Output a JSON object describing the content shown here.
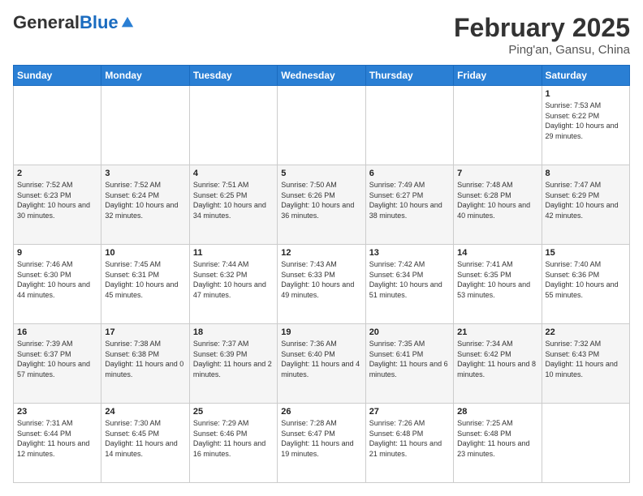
{
  "logo": {
    "general": "General",
    "blue": "Blue"
  },
  "header": {
    "month_year": "February 2025",
    "location": "Ping'an, Gansu, China"
  },
  "weekdays": [
    "Sunday",
    "Monday",
    "Tuesday",
    "Wednesday",
    "Thursday",
    "Friday",
    "Saturday"
  ],
  "weeks": [
    [
      {
        "day": "",
        "info": ""
      },
      {
        "day": "",
        "info": ""
      },
      {
        "day": "",
        "info": ""
      },
      {
        "day": "",
        "info": ""
      },
      {
        "day": "",
        "info": ""
      },
      {
        "day": "",
        "info": ""
      },
      {
        "day": "1",
        "info": "Sunrise: 7:53 AM\nSunset: 6:22 PM\nDaylight: 10 hours and 29 minutes."
      }
    ],
    [
      {
        "day": "2",
        "info": "Sunrise: 7:52 AM\nSunset: 6:23 PM\nDaylight: 10 hours and 30 minutes."
      },
      {
        "day": "3",
        "info": "Sunrise: 7:52 AM\nSunset: 6:24 PM\nDaylight: 10 hours and 32 minutes."
      },
      {
        "day": "4",
        "info": "Sunrise: 7:51 AM\nSunset: 6:25 PM\nDaylight: 10 hours and 34 minutes."
      },
      {
        "day": "5",
        "info": "Sunrise: 7:50 AM\nSunset: 6:26 PM\nDaylight: 10 hours and 36 minutes."
      },
      {
        "day": "6",
        "info": "Sunrise: 7:49 AM\nSunset: 6:27 PM\nDaylight: 10 hours and 38 minutes."
      },
      {
        "day": "7",
        "info": "Sunrise: 7:48 AM\nSunset: 6:28 PM\nDaylight: 10 hours and 40 minutes."
      },
      {
        "day": "8",
        "info": "Sunrise: 7:47 AM\nSunset: 6:29 PM\nDaylight: 10 hours and 42 minutes."
      }
    ],
    [
      {
        "day": "9",
        "info": "Sunrise: 7:46 AM\nSunset: 6:30 PM\nDaylight: 10 hours and 44 minutes."
      },
      {
        "day": "10",
        "info": "Sunrise: 7:45 AM\nSunset: 6:31 PM\nDaylight: 10 hours and 45 minutes."
      },
      {
        "day": "11",
        "info": "Sunrise: 7:44 AM\nSunset: 6:32 PM\nDaylight: 10 hours and 47 minutes."
      },
      {
        "day": "12",
        "info": "Sunrise: 7:43 AM\nSunset: 6:33 PM\nDaylight: 10 hours and 49 minutes."
      },
      {
        "day": "13",
        "info": "Sunrise: 7:42 AM\nSunset: 6:34 PM\nDaylight: 10 hours and 51 minutes."
      },
      {
        "day": "14",
        "info": "Sunrise: 7:41 AM\nSunset: 6:35 PM\nDaylight: 10 hours and 53 minutes."
      },
      {
        "day": "15",
        "info": "Sunrise: 7:40 AM\nSunset: 6:36 PM\nDaylight: 10 hours and 55 minutes."
      }
    ],
    [
      {
        "day": "16",
        "info": "Sunrise: 7:39 AM\nSunset: 6:37 PM\nDaylight: 10 hours and 57 minutes."
      },
      {
        "day": "17",
        "info": "Sunrise: 7:38 AM\nSunset: 6:38 PM\nDaylight: 11 hours and 0 minutes."
      },
      {
        "day": "18",
        "info": "Sunrise: 7:37 AM\nSunset: 6:39 PM\nDaylight: 11 hours and 2 minutes."
      },
      {
        "day": "19",
        "info": "Sunrise: 7:36 AM\nSunset: 6:40 PM\nDaylight: 11 hours and 4 minutes."
      },
      {
        "day": "20",
        "info": "Sunrise: 7:35 AM\nSunset: 6:41 PM\nDaylight: 11 hours and 6 minutes."
      },
      {
        "day": "21",
        "info": "Sunrise: 7:34 AM\nSunset: 6:42 PM\nDaylight: 11 hours and 8 minutes."
      },
      {
        "day": "22",
        "info": "Sunrise: 7:32 AM\nSunset: 6:43 PM\nDaylight: 11 hours and 10 minutes."
      }
    ],
    [
      {
        "day": "23",
        "info": "Sunrise: 7:31 AM\nSunset: 6:44 PM\nDaylight: 11 hours and 12 minutes."
      },
      {
        "day": "24",
        "info": "Sunrise: 7:30 AM\nSunset: 6:45 PM\nDaylight: 11 hours and 14 minutes."
      },
      {
        "day": "25",
        "info": "Sunrise: 7:29 AM\nSunset: 6:46 PM\nDaylight: 11 hours and 16 minutes."
      },
      {
        "day": "26",
        "info": "Sunrise: 7:28 AM\nSunset: 6:47 PM\nDaylight: 11 hours and 19 minutes."
      },
      {
        "day": "27",
        "info": "Sunrise: 7:26 AM\nSunset: 6:48 PM\nDaylight: 11 hours and 21 minutes."
      },
      {
        "day": "28",
        "info": "Sunrise: 7:25 AM\nSunset: 6:48 PM\nDaylight: 11 hours and 23 minutes."
      },
      {
        "day": "",
        "info": ""
      }
    ]
  ]
}
